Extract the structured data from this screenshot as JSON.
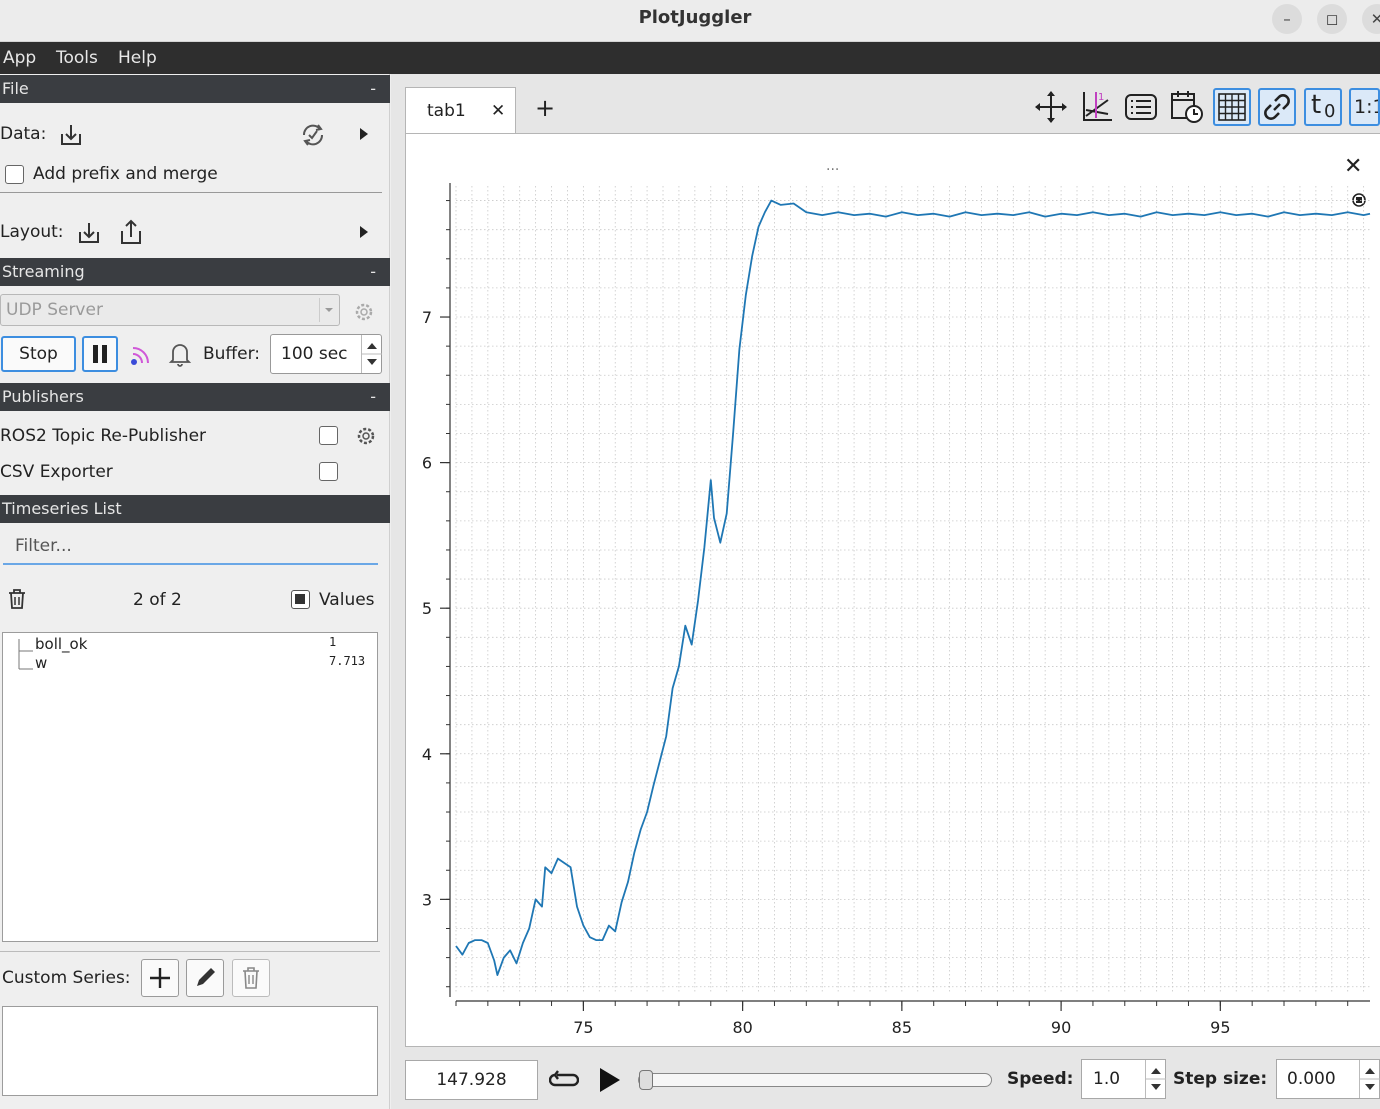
{
  "window": {
    "title": "PlotJuggler",
    "minimize": "–",
    "maximize": "◻",
    "close": "✕"
  },
  "menu": [
    "App",
    "Tools",
    "Help"
  ],
  "file_section": {
    "header": "File",
    "collapse": "-",
    "data_label": "Data:",
    "prefix_label": "Add prefix and merge",
    "prefix_checked": false,
    "layout_label": "Layout:"
  },
  "streaming": {
    "header": "Streaming",
    "collapse": "-",
    "source": "UDP Server",
    "stop_label": "Stop",
    "buffer_label": "Buffer:",
    "buffer_value": "100 sec"
  },
  "publishers": {
    "header": "Publishers",
    "collapse": "-",
    "items": [
      {
        "label": "ROS2 Topic Re-Publisher",
        "checked": false
      },
      {
        "label": "CSV Exporter",
        "checked": false
      }
    ]
  },
  "timeseries": {
    "header": "Timeseries List",
    "filter_placeholder": "Filter...",
    "count": "2 of 2",
    "values_label": "Values",
    "values_checked": true,
    "items": [
      {
        "name": "boll_ok",
        "value": "1"
      },
      {
        "name": "w",
        "value": "7.713"
      }
    ],
    "custom_label": "Custom Series:"
  },
  "tabs": {
    "active": "tab1",
    "close": "✕",
    "add": "+"
  },
  "plot_toolbar": [
    "move-icon",
    "legend-split-icon",
    "list-icon",
    "time-icon",
    "grid-icon",
    "link-icon",
    "t0-icon",
    "ratio-icon"
  ],
  "toolbar_text": {
    "t0": "t",
    "t0_sub": "0",
    "ratio": "1:1"
  },
  "plot_header": {
    "dots": "...",
    "close": "✕"
  },
  "chart_data": {
    "type": "line",
    "series": [
      {
        "name": "w",
        "color": "#1f77b4"
      }
    ],
    "xlim": [
      71,
      99.7
    ],
    "ylim": [
      2.35,
      7.9
    ],
    "xticks": [
      75,
      80,
      85,
      90,
      95
    ],
    "yticks": [
      3,
      4,
      5,
      6,
      7
    ],
    "grid": true,
    "points": [
      [
        71.0,
        2.68
      ],
      [
        71.2,
        2.62
      ],
      [
        71.4,
        2.7
      ],
      [
        71.6,
        2.72
      ],
      [
        71.8,
        2.72
      ],
      [
        72.0,
        2.7
      ],
      [
        72.2,
        2.58
      ],
      [
        72.3,
        2.48
      ],
      [
        72.5,
        2.6
      ],
      [
        72.7,
        2.65
      ],
      [
        72.9,
        2.56
      ],
      [
        73.1,
        2.7
      ],
      [
        73.3,
        2.8
      ],
      [
        73.5,
        3.0
      ],
      [
        73.7,
        2.95
      ],
      [
        73.8,
        3.22
      ],
      [
        74.0,
        3.18
      ],
      [
        74.2,
        3.28
      ],
      [
        74.4,
        3.25
      ],
      [
        74.6,
        3.22
      ],
      [
        74.8,
        2.95
      ],
      [
        75.0,
        2.82
      ],
      [
        75.2,
        2.74
      ],
      [
        75.4,
        2.72
      ],
      [
        75.6,
        2.72
      ],
      [
        75.8,
        2.82
      ],
      [
        76.0,
        2.78
      ],
      [
        76.2,
        2.98
      ],
      [
        76.4,
        3.12
      ],
      [
        76.6,
        3.32
      ],
      [
        76.8,
        3.48
      ],
      [
        77.0,
        3.6
      ],
      [
        77.2,
        3.78
      ],
      [
        77.4,
        3.95
      ],
      [
        77.6,
        4.12
      ],
      [
        77.8,
        4.45
      ],
      [
        78.0,
        4.6
      ],
      [
        78.2,
        4.88
      ],
      [
        78.4,
        4.75
      ],
      [
        78.6,
        5.05
      ],
      [
        78.8,
        5.42
      ],
      [
        79.0,
        5.88
      ],
      [
        79.1,
        5.62
      ],
      [
        79.3,
        5.45
      ],
      [
        79.5,
        5.65
      ],
      [
        79.7,
        6.2
      ],
      [
        79.9,
        6.78
      ],
      [
        80.1,
        7.15
      ],
      [
        80.3,
        7.42
      ],
      [
        80.5,
        7.62
      ],
      [
        80.7,
        7.72
      ],
      [
        80.9,
        7.8
      ],
      [
        81.2,
        7.77
      ],
      [
        81.6,
        7.78
      ],
      [
        82.0,
        7.72
      ],
      [
        82.5,
        7.7
      ],
      [
        83.0,
        7.72
      ],
      [
        83.5,
        7.7
      ],
      [
        84.0,
        7.71
      ],
      [
        84.5,
        7.69
      ],
      [
        85.0,
        7.72
      ],
      [
        85.5,
        7.7
      ],
      [
        86.0,
        7.71
      ],
      [
        86.5,
        7.69
      ],
      [
        87.0,
        7.72
      ],
      [
        87.5,
        7.7
      ],
      [
        88.0,
        7.71
      ],
      [
        88.5,
        7.7
      ],
      [
        89.0,
        7.72
      ],
      [
        89.5,
        7.69
      ],
      [
        90.0,
        7.71
      ],
      [
        90.5,
        7.7
      ],
      [
        91.0,
        7.72
      ],
      [
        91.5,
        7.7
      ],
      [
        92.0,
        7.71
      ],
      [
        92.5,
        7.69
      ],
      [
        93.0,
        7.72
      ],
      [
        93.5,
        7.7
      ],
      [
        94.0,
        7.71
      ],
      [
        94.5,
        7.7
      ],
      [
        95.0,
        7.72
      ],
      [
        95.5,
        7.7
      ],
      [
        96.0,
        7.71
      ],
      [
        96.5,
        7.69
      ],
      [
        97.0,
        7.72
      ],
      [
        97.5,
        7.7
      ],
      [
        98.0,
        7.71
      ],
      [
        98.5,
        7.7
      ],
      [
        99.0,
        7.72
      ],
      [
        99.5,
        7.7
      ],
      [
        99.7,
        7.71
      ]
    ]
  },
  "playback": {
    "time": "147.928",
    "progress": 0.0,
    "speed_label": "Speed:",
    "speed_value": "1.0",
    "step_label": "Step size:",
    "step_value": "0.000"
  }
}
